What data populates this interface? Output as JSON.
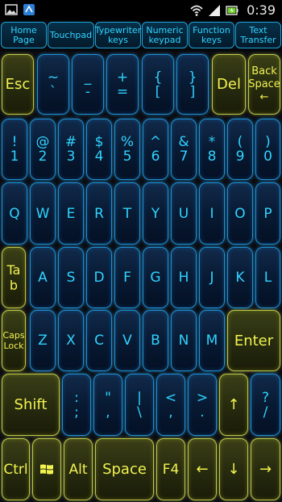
{
  "status_bar": {
    "time": "0:39",
    "icons": [
      "image-icon",
      "app-icon",
      "wifi-icon",
      "signal-icon",
      "battery-charging-icon"
    ]
  },
  "tabs": [
    {
      "label": "Home\nPage"
    },
    {
      "label": "Touchpad"
    },
    {
      "label": "Typewriter\nkeys"
    },
    {
      "label": "Numeric\nkeypad"
    },
    {
      "label": "Function\nkeys"
    },
    {
      "label": "Text\nTransfer"
    }
  ],
  "keys": {
    "esc": "Esc",
    "tilde_top": "~",
    "tilde_bot": "`",
    "minus_top": "_",
    "minus_bot": "-",
    "plus_top": "+",
    "plus_bot": "=",
    "brace_top": "{",
    "brace_bot": "[",
    "cbrace_top": "}",
    "cbrace_bot": "]",
    "del": "Del",
    "backspace": "Back\nSpace\n←",
    "num": [
      {
        "top": "!",
        "bot": "1"
      },
      {
        "top": "@",
        "bot": "2"
      },
      {
        "top": "#",
        "bot": "3"
      },
      {
        "top": "$",
        "bot": "4"
      },
      {
        "top": "%",
        "bot": "5"
      },
      {
        "top": "^",
        "bot": "6"
      },
      {
        "top": "&",
        "bot": "7"
      },
      {
        "top": "*",
        "bot": "8"
      },
      {
        "top": "(",
        "bot": "9"
      },
      {
        "top": ")",
        "bot": "0"
      }
    ],
    "row_q": [
      "Q",
      "W",
      "E",
      "R",
      "T",
      "Y",
      "U",
      "I",
      "O",
      "P"
    ],
    "tab": "Ta\nb",
    "row_a": [
      "A",
      "S",
      "D",
      "F",
      "G",
      "H",
      "J",
      "K",
      "L"
    ],
    "caps": "Caps\nLock",
    "row_z": [
      "Z",
      "X",
      "C",
      "V",
      "B",
      "N",
      "M"
    ],
    "enter": "Enter",
    "shift": "Shift",
    "punct": [
      {
        "top": ":",
        "bot": ";"
      },
      {
        "top": "\"",
        "bot": ","
      },
      {
        "top": "|",
        "bot": "\\"
      },
      {
        "top": "<",
        "bot": ","
      },
      {
        "top": ">",
        "bot": "."
      }
    ],
    "up": "↑",
    "question_top": "?",
    "question_bot": "/",
    "ctrl": "Ctrl",
    "alt": "Alt",
    "space": "Space",
    "f4": "F4",
    "left": "←",
    "down": "↓",
    "right": "→"
  },
  "colors": {
    "blue_key_border": "#1f8fd0",
    "blue_key_text": "#2fd3ff",
    "yellow_key_border": "#b9c94a",
    "yellow_key_text": "#f2f34f",
    "background": "#0b0d12"
  }
}
